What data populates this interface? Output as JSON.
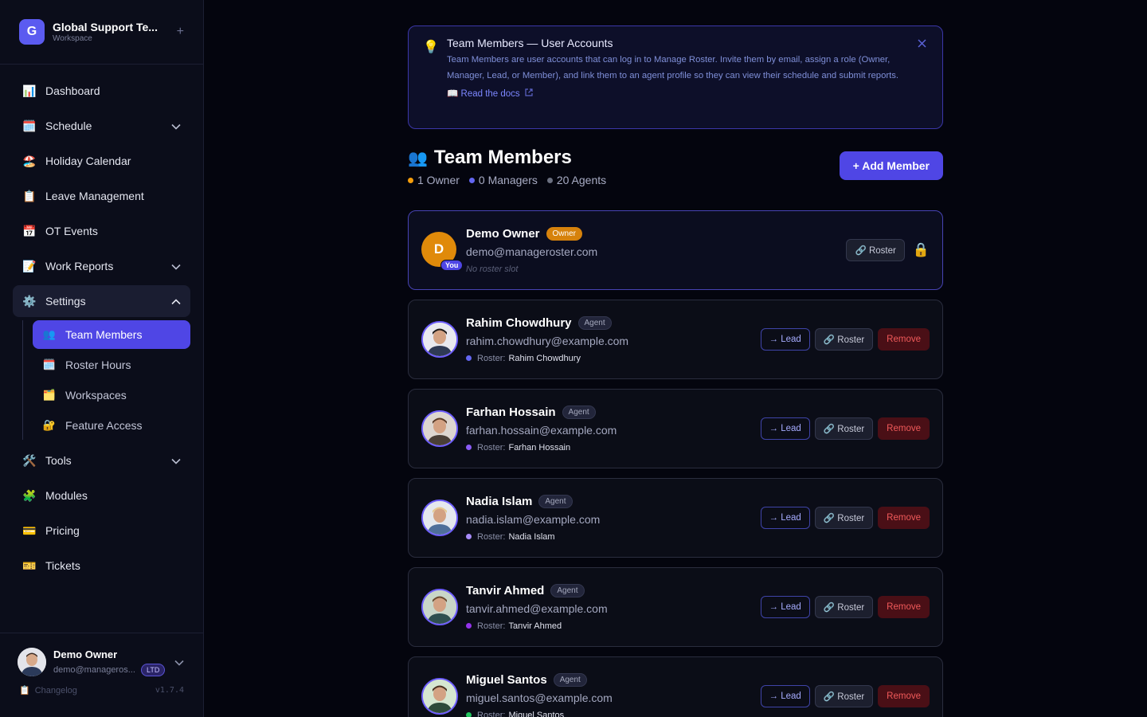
{
  "workspace": {
    "initial": "G",
    "name": "Global Support Te...",
    "sub": "Workspace",
    "add": "+"
  },
  "nav": {
    "dashboard": {
      "icon": "📊",
      "label": "Dashboard"
    },
    "schedule": {
      "icon": "🗓️",
      "label": "Schedule"
    },
    "holiday": {
      "icon": "🏖️",
      "label": "Holiday Calendar"
    },
    "leave": {
      "icon": "📋",
      "label": "Leave Management"
    },
    "ot": {
      "icon": "📅",
      "label": "OT Events"
    },
    "reports": {
      "icon": "📝",
      "label": "Work Reports"
    },
    "settings": {
      "icon": "⚙️",
      "label": "Settings"
    },
    "sub": {
      "team": {
        "icon": "👥",
        "label": "Team Members"
      },
      "roster_hours": {
        "icon": "🗓️",
        "label": "Roster Hours"
      },
      "workspaces": {
        "icon": "🗂️",
        "label": "Workspaces"
      },
      "feature": {
        "icon": "🔐",
        "label": "Feature Access"
      }
    },
    "tools": {
      "icon": "🛠️",
      "label": "Tools"
    },
    "modules": {
      "icon": "🧩",
      "label": "Modules"
    },
    "pricing": {
      "icon": "💳",
      "label": "Pricing"
    },
    "tickets": {
      "icon": "🎫",
      "label": "Tickets"
    }
  },
  "user": {
    "name": "Demo Owner",
    "email": "demo@manageros...",
    "plan": "LTD",
    "changelog": "Changelog",
    "version": "v1.7.4"
  },
  "info": {
    "title": "Team Members — User Accounts",
    "body": "Team Members are user accounts that can log in to Manage Roster. Invite them by email, assign a role (Owner, Manager, Lead, or Member), and link them to an agent profile so they can view their schedule and submit reports.",
    "link": "📖 Read the docs"
  },
  "page": {
    "title_icon": "👥",
    "title": "Team Members",
    "stats": {
      "owners": "1 Owner",
      "managers": "0 Managers",
      "agents": "20 Agents"
    },
    "add_button": "+ Add Member"
  },
  "labels": {
    "lead": "→ Lead",
    "roster": "🔗 Roster",
    "remove": "Remove",
    "roster_prefix": "Roster:"
  },
  "owner": {
    "initial": "D",
    "you": "You",
    "name": "Demo Owner",
    "role": "Owner",
    "email": "demo@manageroster.com",
    "roster": "No roster slot"
  },
  "members": [
    {
      "name": "Rahim Chowdhury",
      "role": "Agent",
      "email": "rahim.chowdhury@example.com",
      "roster": "Rahim Chowdhury",
      "dot": "#6366f1"
    },
    {
      "name": "Farhan Hossain",
      "role": "Agent",
      "email": "farhan.hossain@example.com",
      "roster": "Farhan Hossain",
      "dot": "#8b5cf6"
    },
    {
      "name": "Nadia Islam",
      "role": "Agent",
      "email": "nadia.islam@example.com",
      "roster": "Nadia Islam",
      "dot": "#a78bfa"
    },
    {
      "name": "Tanvir Ahmed",
      "role": "Agent",
      "email": "tanvir.ahmed@example.com",
      "roster": "Tanvir Ahmed",
      "dot": "#9333ea"
    },
    {
      "name": "Miguel Santos",
      "role": "Agent",
      "email": "miguel.santos@example.com",
      "roster": "Miguel Santos",
      "dot": "#22c55e"
    }
  ],
  "colors": {
    "accent": "#4f46e5",
    "owner": "#d6820c",
    "remove": "#f05a5a",
    "background": "#04050e"
  }
}
